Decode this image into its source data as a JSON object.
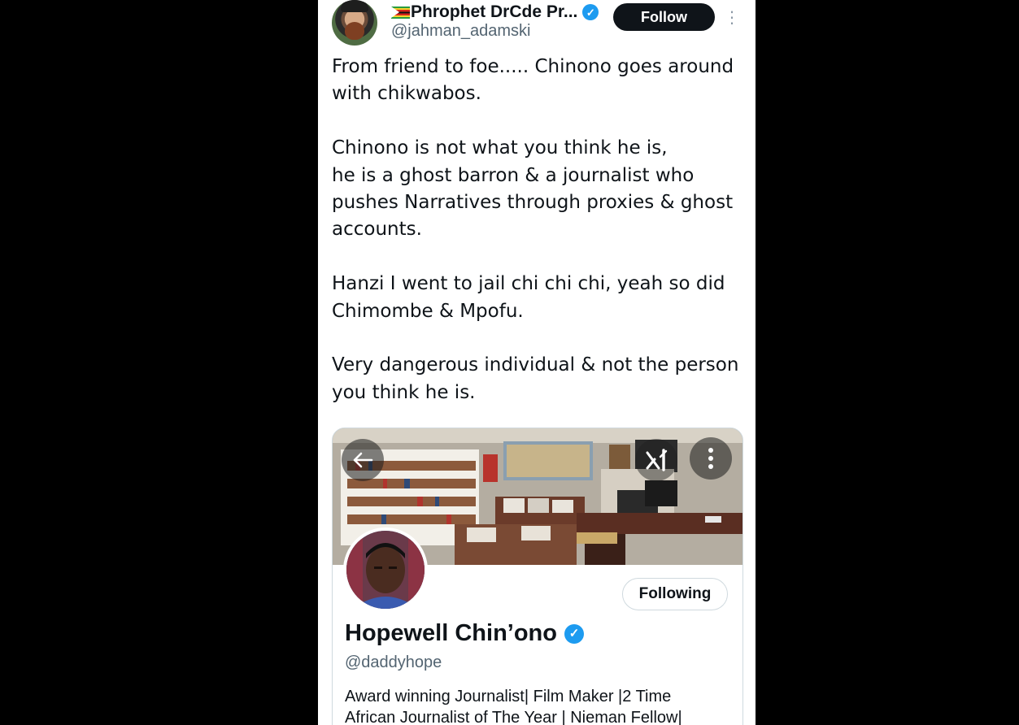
{
  "tweet": {
    "author": {
      "flag": "zimbabwe-flag",
      "display_name": "Phrophet DrCde Pr...",
      "handle": "@jahman_adamski",
      "verified": true
    },
    "follow_label": "Follow",
    "more_icon": "vertical-ellipsis-icon",
    "text_paragraphs": [
      "From friend to foe..... Chinono goes around with chikwabos.",
      "Chinono is not what you think he is,\nhe is a ghost barron & a journalist who pushes Narratives through proxies & ghost accounts.",
      "Hanzi I went to jail chi chi chi, yeah so did Chimombe & Mpofu.",
      "Very dangerous individual & not the person you think he is."
    ]
  },
  "embedded_profile": {
    "back_icon": "arrow-left-icon",
    "brand_icon": "x-logo-icon",
    "more_icon": "vertical-ellipsis-icon",
    "following_label": "Following",
    "name": "Hopewell Chin’ono",
    "verified": true,
    "handle": "@daddyhope",
    "bio_lines": [
      "Award winning Journalist| Film Maker |2 Time",
      "African Journalist of The Year | Nieman Fellow|"
    ]
  },
  "colors": {
    "verified_blue": "#1d9bf0",
    "text_primary": "#0f1419",
    "text_secondary": "#536471",
    "follow_button_bg": "#0f1419",
    "border": "#cfd9de"
  }
}
